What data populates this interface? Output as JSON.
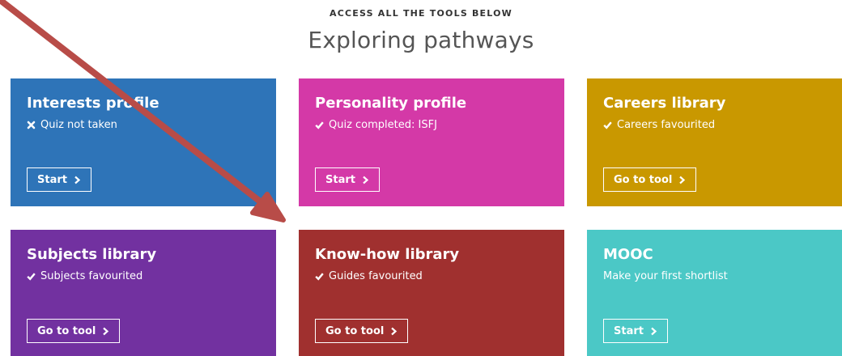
{
  "header": {
    "eyebrow": "ACCESS ALL THE TOOLS BELOW",
    "title": "Exploring pathways"
  },
  "icons": {
    "check": "check-icon",
    "cross": "cross-icon",
    "chevron": "chevron-right-icon"
  },
  "colors": {
    "interests": "#2e74b8",
    "personality": "#d439a7",
    "careers": "#c99800",
    "subjects": "#7231a0",
    "knowhow": "#a0302f",
    "mooc": "#4bc8c6",
    "arrow": "#b84c48"
  },
  "cards": [
    {
      "id": "interests",
      "title": "Interests profile",
      "status": "Quiz not taken",
      "status_icon": "cross",
      "button": "Start"
    },
    {
      "id": "personality",
      "title": "Personality profile",
      "status": "Quiz completed: ISFJ",
      "status_icon": "check",
      "button": "Start"
    },
    {
      "id": "careers",
      "title": "Careers library",
      "status": "Careers favourited",
      "status_icon": "check",
      "button": "Go to tool"
    },
    {
      "id": "subjects",
      "title": "Subjects library",
      "status": "Subjects favourited",
      "status_icon": "check",
      "button": "Go to tool"
    },
    {
      "id": "knowhow",
      "title": "Know-how library",
      "status": "Guides favourited",
      "status_icon": "check",
      "button": "Go to tool"
    },
    {
      "id": "mooc",
      "title": "MOOC",
      "status": "Make your first shortlist",
      "status_icon": "none",
      "button": "Start"
    }
  ]
}
